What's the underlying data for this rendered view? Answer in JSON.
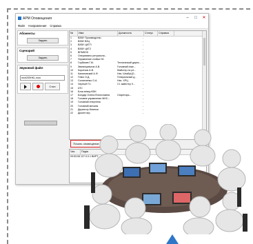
{
  "window": {
    "title": "АРМ Оповещения",
    "min": "–",
    "max": "□",
    "close": "✕"
  },
  "menu": [
    "Файл",
    "Направления",
    "Справка"
  ],
  "subscribers": {
    "title": "Абоненты",
    "button": "Задать"
  },
  "scenario": {
    "title": "Сценарий",
    "button": "Задать"
  },
  "soundfile": {
    "title": "Звуковой файл",
    "path": "rech200HKL.mon",
    "stop_label": "Стоп"
  },
  "table": {
    "headers": [
      "№",
      "Имя",
      "Должность",
      "Статус",
      "Справка"
    ],
    "rows": [
      [
        "1",
        "ВЗВУ Производство",
        ""
      ],
      [
        "2",
        "ВЗВУ ВЗЦ",
        ""
      ],
      [
        "3",
        "ВЗВУ ЦКТП",
        ""
      ],
      [
        "4",
        "ВЗВУ ЦКТ2",
        ""
      ],
      [
        "5",
        "ВПМКО5",
        ""
      ],
      [
        "6",
        "Оперативно ретрансля...",
        ""
      ],
      [
        "7",
        "Управление стойки НС",
        ""
      ],
      [
        "8",
        "Горбачев Г.М.",
        "Технический дирек..."
      ],
      [
        "9",
        "Звягинцевьтов А.В.",
        "Головний інже..."
      ],
      [
        "10",
        "Коротков А.В.",
        "Майстер по ре..."
      ],
      [
        "11",
        "Калиновский А.Ф.",
        "Нач. ШтабуЦО..."
      ],
      [
        "12",
        "Плюх О.Д.",
        "Генеральный д..."
      ],
      [
        "13",
        "Силинченко О.А.",
        "Нач. ХРЦ"
      ],
      [
        "14",
        "Черный П.І.",
        "Ст. майстер Х..."
      ],
      [
        "15",
        "АТС",
        ""
      ],
      [
        "16",
        "Блок вгівку КВН",
        ""
      ],
      [
        "17",
        "Бондар Олена В'ячеславна",
        "Секретарь..."
      ],
      [
        "18",
        "Головне управление МНС...",
        ""
      ],
      [
        "19",
        "Головний енергетик",
        ""
      ],
      [
        "20",
        "Головний механік",
        ""
      ],
      [
        "21",
        "Директор безпеки",
        ""
      ],
      [
        "22",
        "Диспетчер",
        ""
      ]
    ],
    "row_mark": "-"
  },
  "start_button": "Почать оповещение",
  "log": {
    "headers": [
      "Час",
      "Подія"
    ],
    "rows": [
      [
        "09:53:08",
        "127.0.0.1 ВИРТ..."
      ]
    ]
  }
}
